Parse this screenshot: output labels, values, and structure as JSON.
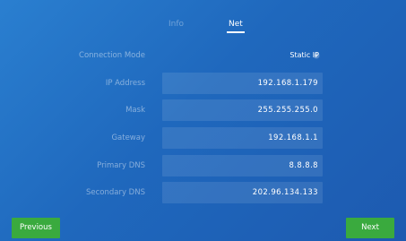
{
  "tabs": {
    "info_label": "Info",
    "net_label": "Net"
  },
  "form": {
    "connection_mode": {
      "label": "Connection Mode",
      "value": "Static IP"
    },
    "ip_address": {
      "label": "IP Address",
      "value": "192.168.1.179"
    },
    "mask": {
      "label": "Mask",
      "value": "255.255.255.0"
    },
    "gateway": {
      "label": "Gateway",
      "value": "192.168.1.1"
    },
    "primary_dns": {
      "label": "Primary DNS",
      "value": "8.8.8.8"
    },
    "secondary_dns": {
      "label": "Secondary DNS",
      "value": "202.96.134.133"
    }
  },
  "buttons": {
    "previous_label": "Previous",
    "next_label": "Next"
  },
  "colors": {
    "background_top": "#2a7fd0",
    "background_bottom": "#1d5ab0",
    "button_green": "#3aaa3e",
    "text_primary": "#ffffff"
  },
  "icons": {
    "dropdown": "chevron-down-icon"
  }
}
